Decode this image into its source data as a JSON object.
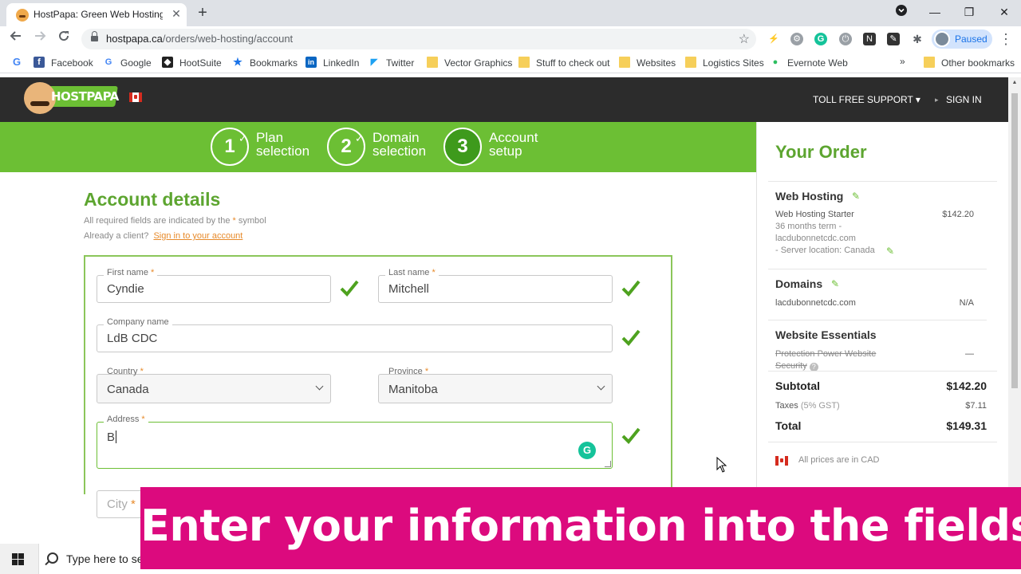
{
  "browser": {
    "tab_title": "HostPapa: Green Web Hosting C",
    "tab_close": "✕",
    "new_tab": "+",
    "url_host": "hostpapa.ca",
    "url_path": "/orders/web-hosting/account",
    "profile_label": "Paused",
    "window_controls": {
      "minimize": "—",
      "maximize": "❐",
      "close": "✕"
    }
  },
  "bookmarks": [
    {
      "label": "Facebook",
      "icon": "facebook-icon",
      "color": "#3b5998"
    },
    {
      "label": "Google",
      "icon": "google-icon",
      "color": "#4285f4"
    },
    {
      "label": "HootSuite",
      "icon": "hootsuite-icon",
      "color": "#222222"
    },
    {
      "label": "Bookmarks",
      "icon": "star-icon",
      "color": "#1a73e8"
    },
    {
      "label": "LinkedIn",
      "icon": "linkedin-icon",
      "color": "#0a66c2"
    },
    {
      "label": "Twitter",
      "icon": "twitter-icon",
      "color": "#1da1f2"
    },
    {
      "label": "Vector Graphics",
      "icon": "folder-icon",
      "color": "#f6cf5a"
    },
    {
      "label": "Stuff to check out",
      "icon": "folder-icon",
      "color": "#f6cf5a"
    },
    {
      "label": "Websites",
      "icon": "folder-icon",
      "color": "#f6cf5a"
    },
    {
      "label": "Logistics Sites",
      "icon": "folder-icon",
      "color": "#f6cf5a"
    },
    {
      "label": "Evernote Web",
      "icon": "evernote-icon",
      "color": "#2dbe60"
    }
  ],
  "bookmarks_overflow": "»",
  "other_bookmarks": "Other bookmarks",
  "site": {
    "logo_text": "HOSTPAPA",
    "toll_free": "TOLL FREE SUPPORT ▾",
    "sign_in": "SIGN IN",
    "sign_in_arrow": "▸"
  },
  "steps": [
    {
      "number": "1",
      "line1": "Plan",
      "line2": "selection",
      "done": true
    },
    {
      "number": "2",
      "line1": "Domain",
      "line2": "selection",
      "done": true
    },
    {
      "number": "3",
      "line1": "Account",
      "line2": "setup",
      "done": false
    }
  ],
  "form": {
    "title": "Account details",
    "required_note_pre": "All required fields are indicated by the",
    "required_star": "*",
    "required_note_post": "symbol",
    "client_note": "Already a client?",
    "sign_in_link": "Sign in to your account",
    "first_name_label": "First name",
    "first_name_value": "Cyndie",
    "last_name_label": "Last name",
    "last_name_value": "Mitchell",
    "company_label": "Company name",
    "company_value": "LdB CDC",
    "country_label": "Country",
    "country_value": "Canada",
    "province_label": "Province",
    "province_value": "Manitoba",
    "address_label": "Address",
    "address_value": "B",
    "city_placeholder": "City",
    "star": "*",
    "grammarly": "G"
  },
  "order": {
    "title": "Your Order",
    "hosting_title": "Web Hosting",
    "hosting_plan": "Web Hosting Starter",
    "hosting_price": "$142.20",
    "hosting_term": "36 months term -",
    "hosting_domain": "lacdubonnetcdc.com",
    "hosting_server": "- Server location: Canada",
    "domains_title": "Domains",
    "domain_name": "lacdubonnetcdc.com",
    "domain_price": "N/A",
    "essentials_title": "Website Essentials",
    "essentials_item_1": "Protection Power Website",
    "essentials_item_2": "Security",
    "essentials_price": "—",
    "help": "?",
    "subtotal_label": "Subtotal",
    "subtotal_value": "$142.20",
    "taxes_label": "Taxes",
    "taxes_note": "(5% GST)",
    "taxes_value": "$7.11",
    "total_label": "Total",
    "total_value": "$149.31",
    "currency_note": "All prices are in CAD"
  },
  "taskbar": {
    "search_text": "Type here to se"
  },
  "caption": {
    "text": "Enter your information into the fields."
  },
  "colors": {
    "brand_green": "#6cbf34",
    "caption_magenta": "#dc0a7e",
    "header_dark": "#2c2c2c"
  }
}
